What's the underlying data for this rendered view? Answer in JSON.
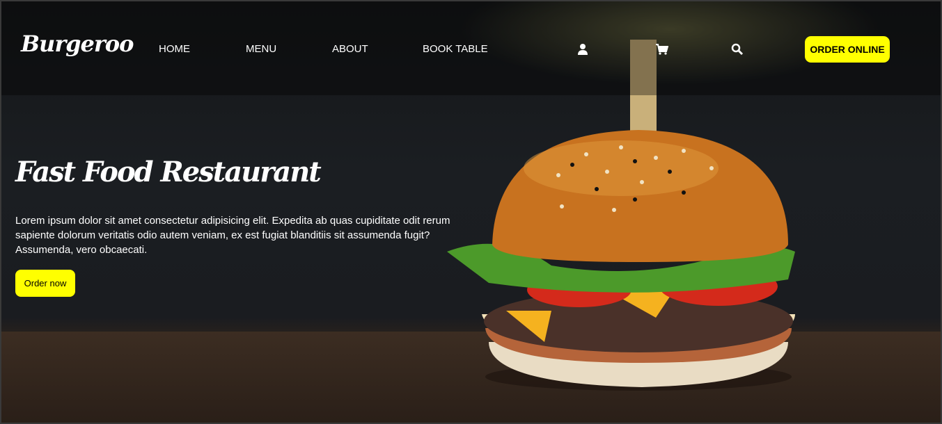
{
  "header": {
    "logo": "Burgeroo",
    "nav": [
      "HOME",
      "MENU",
      "ABOUT",
      "BOOK TABLE"
    ],
    "icons": [
      "user-icon",
      "cart-icon",
      "search-icon"
    ],
    "order_online": "ORDER ONLINE"
  },
  "hero": {
    "title": "Fast Food Restaurant",
    "description": "Lorem ipsum dolor sit amet consectetur adipisicing elit. Expedita ab quas cupiditate odit rerum sapiente dolorum veritatis odio autem veniam, ex est fugiat blanditiis sit assumenda fugit? Assumenda, vero obcaecati.",
    "button": "Order now"
  },
  "colors": {
    "accent": "#ffff00",
    "text": "#ffffff"
  }
}
